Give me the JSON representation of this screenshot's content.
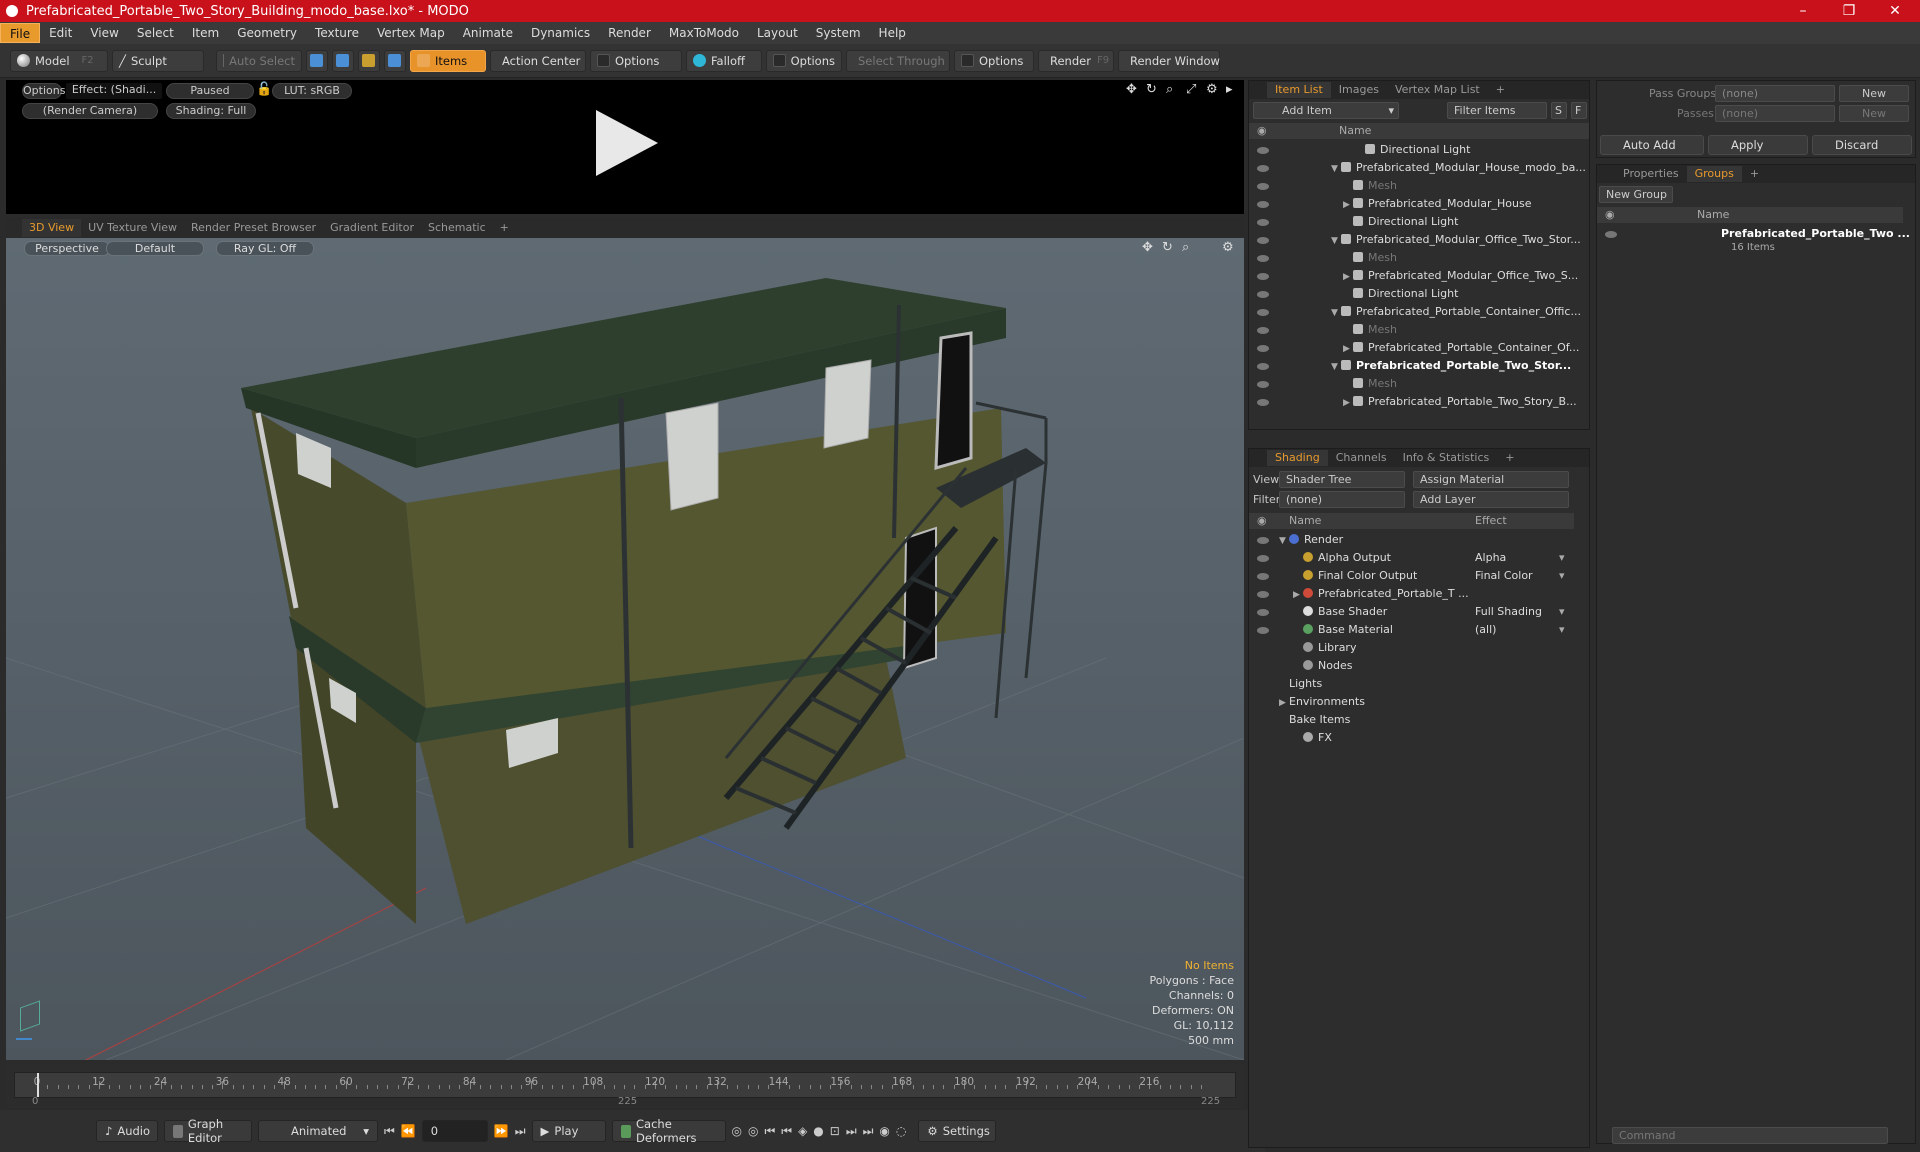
{
  "window": {
    "title": "Prefabricated_Portable_Two_Story_Building_modo_base.lxo* - MODO",
    "controls": [
      "–",
      "❐",
      "✕"
    ]
  },
  "menu": [
    "File",
    "Edit",
    "View",
    "Select",
    "Item",
    "Geometry",
    "Texture",
    "Vertex Map",
    "Animate",
    "Dynamics",
    "Render",
    "MaxToModo",
    "Layout",
    "System",
    "Help"
  ],
  "toolbar": {
    "model": "Model",
    "model_key": "F2",
    "sculpt": "Sculpt",
    "auto_select": "Auto Select",
    "items": "Items",
    "action_center": "Action Center",
    "options1": "Options",
    "falloff": "Falloff",
    "options2": "Options",
    "select_through": "Select Through",
    "options3": "Options",
    "render": "Render",
    "render_key": "F9",
    "render_window": "Render Window"
  },
  "preview": {
    "options": "Options",
    "effect": "Effect: (Shadi...",
    "paused": "Paused",
    "lut": "LUT: sRGB",
    "camera": "(Render Camera)",
    "shading": "Shading: Full"
  },
  "viewtabs": [
    "3D View",
    "UV Texture View",
    "Render Preset Browser",
    "Gradient Editor",
    "Schematic",
    "+"
  ],
  "viewport": {
    "perspective": "Perspective",
    "default": "Default",
    "raygl": "Ray GL: Off"
  },
  "stats": {
    "no_items": "No Items",
    "polygons": "Polygons : Face",
    "channels": "Channels: 0",
    "deformers": "Deformers: ON",
    "gl": "GL: 10,112",
    "scale": "500 mm"
  },
  "timeline": {
    "labels": [
      "0",
      "12",
      "24",
      "36",
      "48",
      "60",
      "72",
      "84",
      "96",
      "108",
      "120",
      "132",
      "144",
      "156",
      "168",
      "180",
      "192",
      "204",
      "216"
    ],
    "start": "0",
    "mid": "225",
    "end": "225"
  },
  "bottom": {
    "audio": "Audio",
    "graph_editor": "Graph Editor",
    "animated": "Animated",
    "frame": "0",
    "play": "Play",
    "cache": "Cache Deformers",
    "settings": "Settings"
  },
  "itemlist": {
    "tabs": [
      "Item List",
      "Images",
      "Vertex Map List",
      "+"
    ],
    "add_item": "Add Item",
    "filter": "Filter Items",
    "s": "S",
    "f": "F",
    "col_name": "Name",
    "rows": [
      {
        "t": "Directional Light",
        "ind": 3,
        "dim": false,
        "arrow": ""
      },
      {
        "t": "Prefabricated_Modular_House_modo_ba...",
        "ind": 1,
        "dim": false,
        "arrow": "▼"
      },
      {
        "t": "Mesh",
        "ind": 2,
        "dim": true,
        "arrow": ""
      },
      {
        "t": "Prefabricated_Modular_House",
        "ind": 2,
        "dim": false,
        "arrow": "▶"
      },
      {
        "t": "Directional Light",
        "ind": 2,
        "dim": false,
        "arrow": ""
      },
      {
        "t": "Prefabricated_Modular_Office_Two_Stor...",
        "ind": 1,
        "dim": false,
        "arrow": "▼"
      },
      {
        "t": "Mesh",
        "ind": 2,
        "dim": true,
        "arrow": ""
      },
      {
        "t": "Prefabricated_Modular_Office_Two_S...",
        "ind": 2,
        "dim": false,
        "arrow": "▶"
      },
      {
        "t": "Directional Light",
        "ind": 2,
        "dim": false,
        "arrow": ""
      },
      {
        "t": "Prefabricated_Portable_Container_Offic...",
        "ind": 1,
        "dim": false,
        "arrow": "▼"
      },
      {
        "t": "Mesh",
        "ind": 2,
        "dim": true,
        "arrow": ""
      },
      {
        "t": "Prefabricated_Portable_Container_Of...",
        "ind": 2,
        "dim": false,
        "arrow": "▶"
      },
      {
        "t": "Prefabricated_Portable_Two_Stor...",
        "ind": 1,
        "dim": false,
        "arrow": "▼",
        "bold": true
      },
      {
        "t": "Mesh",
        "ind": 2,
        "dim": true,
        "arrow": ""
      },
      {
        "t": "Prefabricated_Portable_Two_Story_B...",
        "ind": 2,
        "dim": false,
        "arrow": "▶"
      }
    ]
  },
  "shading": {
    "tabs": [
      "Shading",
      "Channels",
      "Info & Statistics",
      "+"
    ],
    "view_label": "View",
    "view_value": "Shader Tree",
    "assign": "Assign Material",
    "filter_label": "Filter",
    "filter_value": "(none)",
    "add_layer": "Add Layer",
    "col_name": "Name",
    "col_effect": "Effect",
    "rows": [
      {
        "t": "Render",
        "e": "",
        "ind": 0,
        "arrow": "▼",
        "c": "#4a6fd0"
      },
      {
        "t": "Alpha Output",
        "e": "Alpha",
        "ind": 1,
        "arrow": "",
        "c": "#c8a030"
      },
      {
        "t": "Final Color Output",
        "e": "Final Color",
        "ind": 1,
        "arrow": "",
        "c": "#c8a030"
      },
      {
        "t": "Prefabricated_Portable_T ...",
        "e": "",
        "ind": 1,
        "arrow": "▶",
        "c": "#d04a3a"
      },
      {
        "t": "Base Shader",
        "e": "Full Shading",
        "ind": 1,
        "arrow": "",
        "c": "#dddddd"
      },
      {
        "t": "Base Material",
        "e": "(all)",
        "ind": 1,
        "arrow": "",
        "c": "#5aa060"
      },
      {
        "t": "Library",
        "e": "",
        "ind": 1,
        "arrow": "",
        "c": "#999999"
      },
      {
        "t": "Nodes",
        "e": "",
        "ind": 1,
        "arrow": "",
        "c": "#999999"
      },
      {
        "t": "Lights",
        "e": "",
        "ind": 0,
        "arrow": "",
        "c": ""
      },
      {
        "t": "Environments",
        "e": "",
        "ind": 0,
        "arrow": "▶",
        "c": ""
      },
      {
        "t": "Bake Items",
        "e": "",
        "ind": 0,
        "arrow": "",
        "c": ""
      },
      {
        "t": "FX",
        "e": "",
        "ind": 1,
        "arrow": "",
        "c": "#aaaaaa"
      }
    ]
  },
  "passes": {
    "pass_groups": "Pass Groups",
    "pass_groups_val": "(none)",
    "new1": "New",
    "passes": "Passes",
    "passes_val": "(none)",
    "new2": "New",
    "auto_add": "Auto Add",
    "apply": "Apply",
    "discard": "Discard"
  },
  "groups": {
    "tabs": [
      "Properties",
      "Groups",
      "+"
    ],
    "new_group": "New Group",
    "col_name": "Name",
    "item": "Prefabricated_Portable_Two ...",
    "count": "16 Items"
  },
  "command": {
    "placeholder": "Command"
  }
}
